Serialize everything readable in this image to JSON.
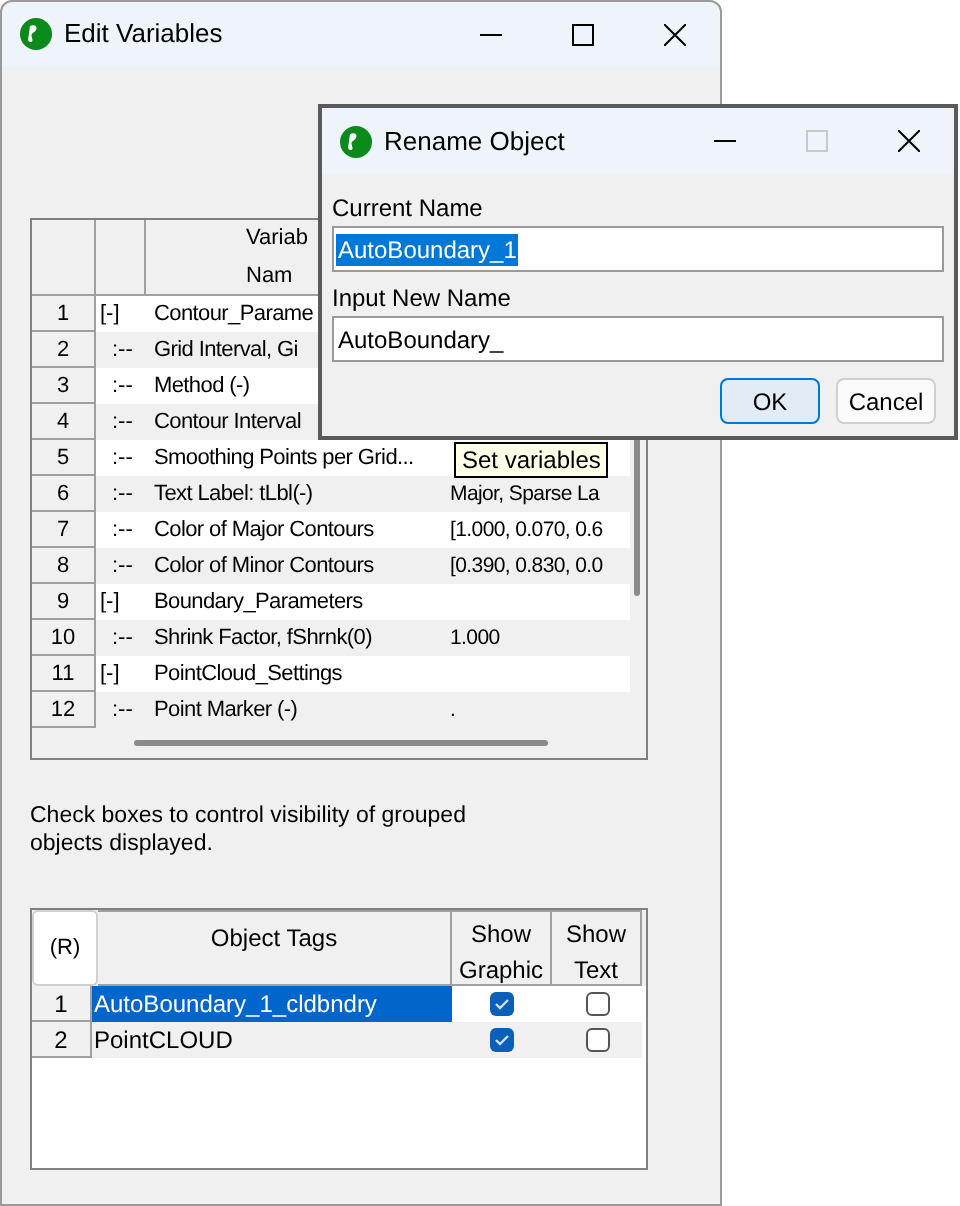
{
  "window": {
    "title": "Edit Variables"
  },
  "variables_table": {
    "header_lines": [
      "Variab",
      "Nam"
    ],
    "rows": [
      {
        "number": "1",
        "marker": "[-]",
        "name": "Contour_Parame",
        "children": [
          {
            "number": "2",
            "marker": ":--",
            "name": "Grid Interval, Gi"
          },
          {
            "number": "3",
            "marker": ":--",
            "name": "Method (-)"
          },
          {
            "number": "4",
            "marker": ":--",
            "name": "Contour Interval"
          },
          {
            "number": "5",
            "marker": ":--",
            "name": "Smoothing Points per Grid..."
          },
          {
            "number": "6",
            "marker": ":--",
            "name": "Text Label: tLbl(-)",
            "value": "Major, Sparse La"
          },
          {
            "number": "7",
            "marker": ":--",
            "name": "Color of Major Contours",
            "value": "[1.000, 0.070, 0.6"
          },
          {
            "number": "8",
            "marker": ":--",
            "name": "Color of Minor Contours",
            "value": "[0.390, 0.830, 0.0"
          }
        ]
      },
      {
        "number": "9",
        "marker": "[-]",
        "name": "Boundary_Parameters",
        "children": [
          {
            "number": "10",
            "marker": ":--",
            "name": "Shrink Factor, fShrnk(0)",
            "value": "1.000"
          }
        ]
      },
      {
        "number": "11",
        "marker": "[-]",
        "name": "PointCloud_Settings",
        "children": [
          {
            "number": "12",
            "marker": ":--",
            "name": "Point Marker (-)",
            "value": "."
          }
        ]
      }
    ]
  },
  "tooltip": "Set variables",
  "instructions": "Check boxes to control visibility of grouped objects displayed.",
  "tags_table": {
    "corner": "(R)",
    "columns": [
      "Object Tags",
      "Show Graphic",
      "Show Text"
    ],
    "rows": [
      {
        "number": "1",
        "tag": "AutoBoundary_1_cldbndry",
        "selected": true,
        "show_graphic": true,
        "show_text": false
      },
      {
        "number": "2",
        "tag": "PointCLOUD",
        "selected": false,
        "show_graphic": true,
        "show_text": false
      }
    ]
  },
  "dialog": {
    "title": "Rename Object",
    "fields": [
      {
        "label": "Current Name",
        "value": "AutoBoundary_1",
        "selected": true
      },
      {
        "label": "Input New Name",
        "value": "AutoBoundary_",
        "selected": false
      }
    ],
    "buttons": [
      {
        "label": "OK",
        "default": true
      },
      {
        "label": "Cancel",
        "default": false
      }
    ]
  }
}
